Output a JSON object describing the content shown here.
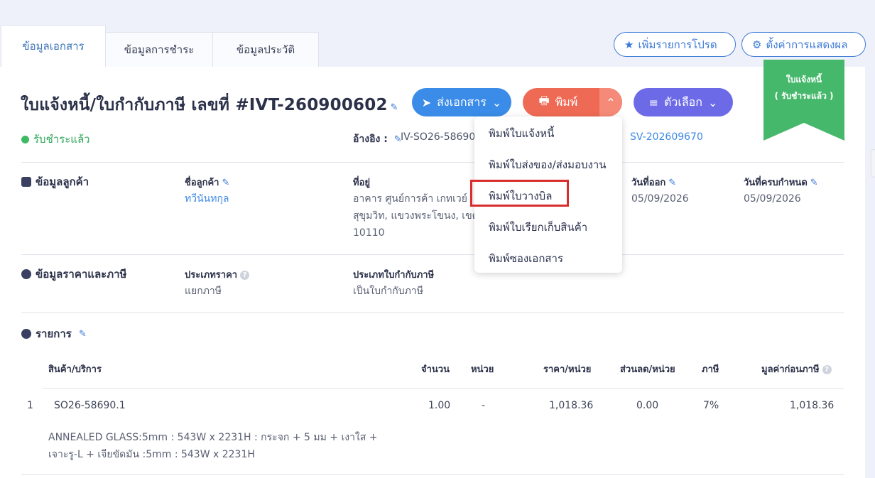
{
  "tabs": [
    "ข้อมูลเอกสาร",
    "ข้อมูลการชำระ",
    "ข้อมูลประวัติ"
  ],
  "top_actions": {
    "favorite": "เพิ่มรายการโปรด",
    "display_settings": "ตั้งค่าการแสดงผล"
  },
  "document": {
    "title": "ใบแจ้งหนี้/ใบกำกับภาษี เลขที่ #IVT-260900602",
    "status": "รับชำระแล้ว",
    "ref_label": "อ้างอิง :",
    "ref_value": "IV-SO26-58690",
    "ref_link": "SV-202609670"
  },
  "buttons": {
    "send": "ส่งเอกสาร",
    "print": "พิมพ์",
    "options": "ตัวเลือก"
  },
  "ribbon": {
    "line1": "ใบแจ้งหนี้",
    "line2": "( รับชำระแล้ว )"
  },
  "print_menu": [
    "พิมพ์ใบแจ้งหนี้",
    "พิมพ์ใบส่งของ/ส่งมอบงาน",
    "พิมพ์ใบวางบิล",
    "พิมพ์ใบเรียกเก็บสินค้า",
    "พิมพ์ซองเอกสาร"
  ],
  "customer": {
    "section": "ข้อมูลลูกค้า",
    "name_label": "ชื่อลูกค้า",
    "name": "ทวีนันทกุล",
    "address_label": "ที่อยู่",
    "address_line1": "อาคาร ศูนย์การค้า เกทเวย์",
    "address_line2": "สุขุมวิท, แขวงพระโขนง, เขต",
    "address_line3": "10110",
    "issue_label": "วันที่ออก",
    "issue_date": "05/09/2026",
    "due_label": "วันที่ครบกำหนด",
    "due_date": "05/09/2026"
  },
  "pricing": {
    "section": "ข้อมูลราคาและภาษี",
    "price_type_label": "ประเภทราคา",
    "price_type": "แยกภาษี",
    "tax_doc_label": "ประเภทใบกำกับภาษี",
    "tax_doc": "เป็นใบกำกับภาษี"
  },
  "items": {
    "section": "รายการ",
    "headers": [
      "สินค้า/บริการ",
      "จำนวน",
      "หน่วย",
      "ราคา/หน่วย",
      "ส่วนลด/หน่วย",
      "ภาษี",
      "มูลค่าก่อนภาษี"
    ],
    "rows": [
      {
        "no": "1",
        "product": "SO26-58690.1",
        "qty": "1.00",
        "unit": "-",
        "price": "1,018.36",
        "discount": "0.00",
        "tax": "7%",
        "amount": "1,018.36",
        "desc_line1": "ANNEALED GLASS:5mm : 543W x 2231H : กระจก + 5 มม + เงาใส +",
        "desc_line2": "เจาะรู-L + เจียขัดมัน :5mm : 543W x 2231H"
      }
    ]
  },
  "colors": {
    "accent": "#3c7ad7",
    "print": "#ef6a55",
    "options": "#6d6ae8",
    "paid": "#46b86b",
    "highlight": "#d92c2c"
  }
}
